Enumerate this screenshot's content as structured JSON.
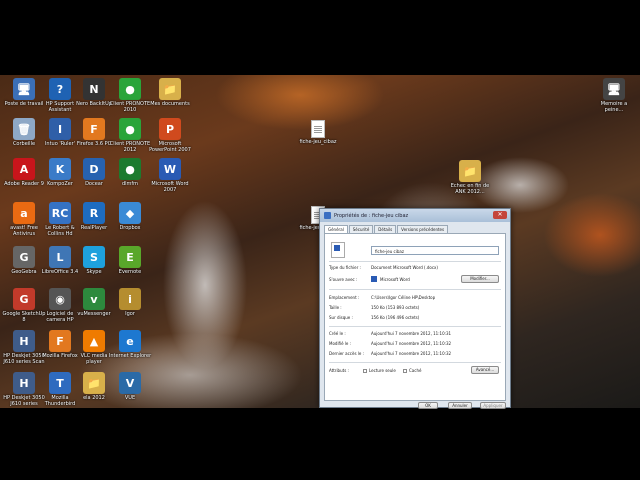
{
  "desktop": {
    "icons": [
      {
        "label": "Poste de travail",
        "glyph": "🖥",
        "color": "#3b6fb7"
      },
      {
        "label": "HP Support Assistant",
        "glyph": "?",
        "color": "#1f62b3"
      },
      {
        "label": "Nero BackItUp",
        "glyph": "N",
        "color": "#333"
      },
      {
        "label": "Client PRONOTE 2010",
        "glyph": "●",
        "color": "#2aa43a"
      },
      {
        "label": "Mes documents",
        "glyph": "📁",
        "color": "#d8b04a"
      },
      {
        "label": "Corbeille",
        "glyph": "🗑",
        "color": "#8ea8c6"
      },
      {
        "label": "Intuo 'Ruler'",
        "glyph": "I",
        "color": "#2f5fa8"
      },
      {
        "label": "Firefox 3.6 PC",
        "glyph": "F",
        "color": "#e2781f"
      },
      {
        "label": "Client PRONOTE 2012",
        "glyph": "●",
        "color": "#2aa43a"
      },
      {
        "label": "Microsoft PowerPoint 2007",
        "glyph": "P",
        "color": "#d04a1e"
      },
      {
        "label": "Adobe Reader 9",
        "glyph": "A",
        "color": "#c8151b"
      },
      {
        "label": "KompoZer",
        "glyph": "K",
        "color": "#3a7bc8"
      },
      {
        "label": "Docear",
        "glyph": "D",
        "color": "#2762b0"
      },
      {
        "label": "dlmfm",
        "glyph": "●",
        "color": "#1c7a2e"
      },
      {
        "label": "Microsoft Word 2007",
        "glyph": "W",
        "color": "#2a5bb4"
      },
      {
        "label": "avast! Free Antivirus",
        "glyph": "a",
        "color": "#ea6a12"
      },
      {
        "label": "Le Robert & Collins Hd",
        "glyph": "RC",
        "color": "#3572c4"
      },
      {
        "label": "RealPlayer",
        "glyph": "R",
        "color": "#1e6cc0"
      },
      {
        "label": "Dropbox",
        "glyph": "◆",
        "color": "#3a8ad6"
      },
      {
        "label": "GeoGebra",
        "glyph": "G",
        "color": "#666"
      },
      {
        "label": "LibreOffice 3.4",
        "glyph": "L",
        "color": "#3f76b5"
      },
      {
        "label": "Skype",
        "glyph": "S",
        "color": "#1ea1dd"
      },
      {
        "label": "Evernote",
        "glyph": "E",
        "color": "#59a72a"
      },
      {
        "label": "Google SketchUp 8",
        "glyph": "G",
        "color": "#c23a2a"
      },
      {
        "label": "Logiciel de camera HP",
        "glyph": "◉",
        "color": "#555"
      },
      {
        "label": "vuMessenger",
        "glyph": "v",
        "color": "#2d8a3d"
      },
      {
        "label": "Igor",
        "glyph": "i",
        "color": "#b58d2f"
      },
      {
        "label": "HP Deskjet 3050 J610 series Scan",
        "glyph": "H",
        "color": "#3f5c8a"
      },
      {
        "label": "Mozilla Firefox",
        "glyph": "F",
        "color": "#e2781f"
      },
      {
        "label": "VLC media player",
        "glyph": "▲",
        "color": "#ef7b00"
      },
      {
        "label": "Internet Explorer",
        "glyph": "e",
        "color": "#1d78d0"
      },
      {
        "label": "HP Deskjet 3050 J610 series",
        "glyph": "H",
        "color": "#3f5c8a"
      },
      {
        "label": "Mozilla Thunderbird",
        "glyph": "T",
        "color": "#2f6bbf"
      },
      {
        "label": "ela 2012",
        "glyph": "📁",
        "color": "#d8b04a"
      },
      {
        "label": "VUE",
        "glyph": "V",
        "color": "#2a6aa7"
      },
      {
        "label": "fiche-jeu_cibaz",
        "glyph": "",
        "color": "#eee"
      },
      {
        "label": "fiche-jeu_cibaz",
        "glyph": "",
        "color": "#eee"
      },
      {
        "label": "Echec en fin de ANK 2012...",
        "glyph": "📁",
        "color": "#d8b04a"
      },
      {
        "label": "Memoire a peine...",
        "glyph": "🖥",
        "color": "#444"
      }
    ]
  },
  "dialog": {
    "title": "Propriétés de : fiche-jeu cibaz",
    "close_glyph": "✕",
    "tabs": [
      "Général",
      "Sécurité",
      "Détails",
      "Versions précédentes"
    ],
    "file_name": "fiche-jeu cibaz",
    "type_label": "Type du fichier :",
    "type_value": "Document Microsoft Word (.docx)",
    "open_with_label": "S'ouvre avec :",
    "open_with_value": "Microsoft Word",
    "modify_button": "Modifier...",
    "location_label": "Emplacement :",
    "location_value": "C:\\Users\\Igor Céline HP\\Desktop",
    "size_label": "Taille :",
    "size_value": "150 Ko (153 893 octets)",
    "disk_size_label": "Sur disque :",
    "disk_size_value": "156 Ko (196 496 octets)",
    "created_label": "Créé le :",
    "created_value": "Aujourd'hui 7 novembre 2012, 11:10:31",
    "modified_label": "Modifié le :",
    "modified_value": "Aujourd'hui 7 novembre 2012, 11:10:32",
    "accessed_label": "Dernier accès le :",
    "accessed_value": "Aujourd'hui 7 novembre 2012, 11:10:32",
    "attributes_label": "Attributs :",
    "readonly_label": "Lecture seule",
    "hidden_label": "Caché",
    "advanced_button": "Avancé...",
    "ok_button": "OK",
    "cancel_button": "Annuler",
    "apply_button": "Appliquer"
  }
}
